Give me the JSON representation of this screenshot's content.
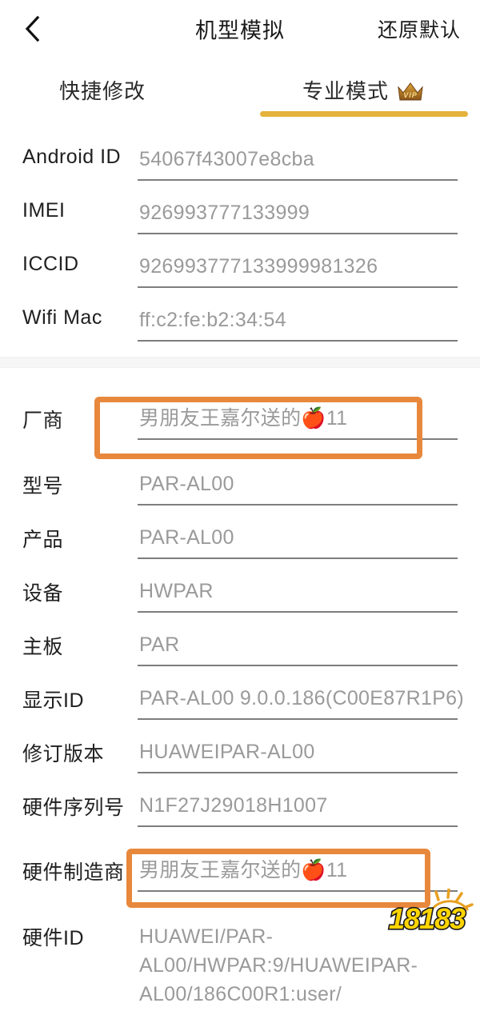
{
  "navbar": {
    "back_icon": "chevron-left-icon",
    "title": "机型模拟",
    "action_label": "还原默认"
  },
  "tabs": {
    "items": [
      {
        "label": "快捷修改",
        "active": false
      },
      {
        "label": "专业模式",
        "active": true,
        "badge": "VIP"
      }
    ],
    "active_underline_color": "#e5b33c",
    "arrow_color": "#e8833c",
    "arrow_icon": "arrow-right-pointer-icon"
  },
  "colors": {
    "highlight_border": "#e8883c",
    "tab_underline": "#e5b33c",
    "label_text": "#202020",
    "value_text": "#9a9a9a",
    "field_line": "#7d7d7d",
    "divider": "#f6f6f6",
    "vip_badge": "#b5762a"
  },
  "sections": [
    {
      "name": "identifiers",
      "rows": [
        {
          "label": "Android ID",
          "value": "54067f43007e8cba",
          "highlighted": false
        },
        {
          "label": "IMEI",
          "value": "926993777133999",
          "highlighted": false
        },
        {
          "label": "ICCID",
          "value": "926993777133999981326",
          "highlighted": false
        },
        {
          "label": "Wifi Mac",
          "value": "ff:c2:fe:b2:34:54",
          "highlighted": false
        }
      ]
    },
    {
      "name": "device-properties",
      "rows": [
        {
          "label": "厂商",
          "value": "男朋友王嘉尔送的🍎11",
          "highlighted": true
        },
        {
          "label": "型号",
          "value": "PAR-AL00",
          "highlighted": false
        },
        {
          "label": "产品",
          "value": "PAR-AL00",
          "highlighted": false
        },
        {
          "label": "设备",
          "value": "HWPAR",
          "highlighted": false
        },
        {
          "label": "主板",
          "value": "PAR",
          "highlighted": false
        },
        {
          "label": "显示ID",
          "value": "PAR-AL00 9.0.0.186(C00E87R1P6)",
          "highlighted": false
        },
        {
          "label": "修订版本",
          "value": "HUAWEIPAR-AL00",
          "highlighted": false
        },
        {
          "label": "硬件序列号",
          "value": "N1F27J29018H1007",
          "highlighted": false
        },
        {
          "label": "硬件制造商",
          "value": "男朋友王嘉尔送的🍎11",
          "highlighted": true
        },
        {
          "label": "硬件ID",
          "value": "HUAWEI/PAR-AL00/HWPAR:9/HUAWEIPAR-AL00/186C00R1:user/",
          "highlighted": false
        }
      ]
    }
  ],
  "watermark": {
    "text": "18183",
    "icon": "18183-logo-watermark"
  }
}
